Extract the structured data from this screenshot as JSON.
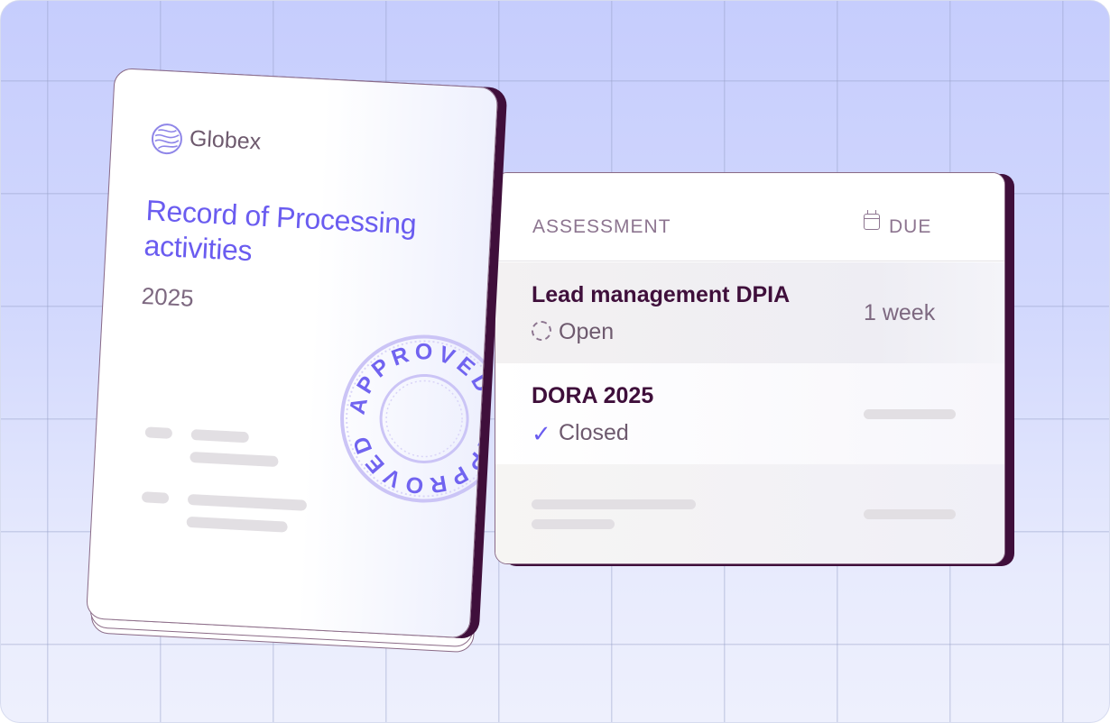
{
  "document": {
    "brand": "Globex",
    "title": "Record of Processing activities",
    "year": "2025",
    "stamp_text": "APPROVED • APPROVED •",
    "colors": {
      "accent": "#6a5cf0",
      "ink": "#3f0f3b",
      "stamp": "#c9c2f6"
    }
  },
  "table": {
    "headers": {
      "assessment": "ASSESSMENT",
      "due": "DUE"
    },
    "rows": [
      {
        "title": "Lead management DPIA",
        "status": "Open",
        "status_icon": "dashed-circle-icon",
        "due": "1 week"
      },
      {
        "title": "DORA 2025",
        "status": "Closed",
        "status_icon": "check-icon",
        "due": ""
      }
    ]
  }
}
